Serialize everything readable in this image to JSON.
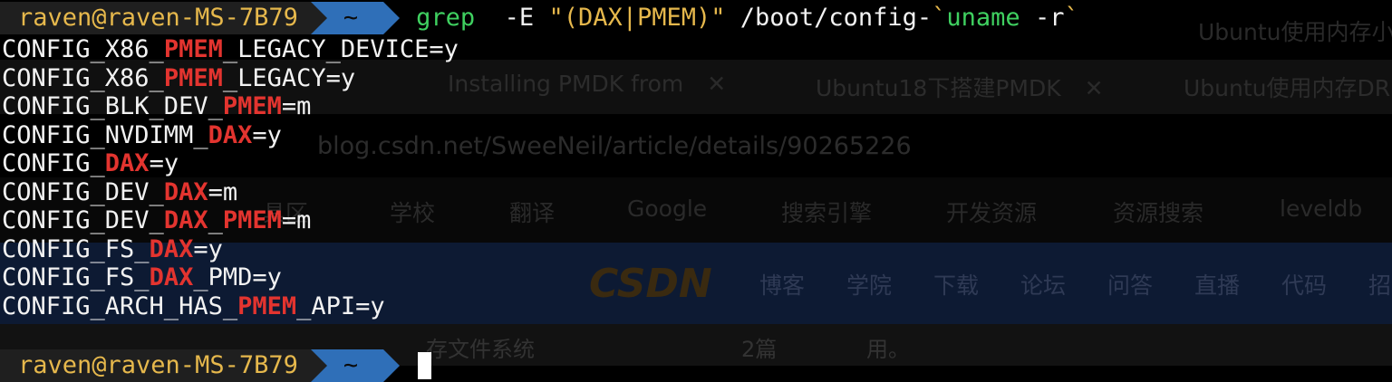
{
  "background": {
    "tabs": [
      {
        "label": "Installing PMDK from",
        "close": "✕"
      },
      {
        "label": "Ubuntu18下搭建PMDK",
        "close": "✕"
      },
      {
        "label": "Ubuntu使用内存DR",
        "close": ""
      }
    ],
    "top_right_title": "Ubuntu使用内存小",
    "url": "blog.csdn.net/SweeNeil/article/details/90265226",
    "bookmarks": [
      "具区",
      "学校",
      "翻译",
      "Google",
      "搜索引擎",
      "开发资源",
      "资源搜索",
      "leveldb"
    ],
    "logo": "CSDN",
    "nav_items": [
      "博客",
      "学院",
      "下载",
      "论坛",
      "问答",
      "直播",
      "代码",
      "招"
    ],
    "bottom_text_left": "存文件系统",
    "bottom_text_mid": "2篇",
    "bottom_text_right": "用。"
  },
  "prompt": {
    "user_host": "raven@raven-MS-7B79",
    "directory": "~"
  },
  "command": {
    "program": "grep",
    "option": "-E",
    "pattern": "\"(DAX|PMEM)\"",
    "path": "/boot/config-",
    "tick_open": "`",
    "subcommand": "uname",
    "subcommand_arg": "-r",
    "tick_close": "`"
  },
  "output_lines": [
    [
      [
        "CONFIG_X86_",
        false
      ],
      [
        "PMEM",
        true
      ],
      [
        "_LEGACY_DEVICE=y",
        false
      ]
    ],
    [
      [
        "CONFIG_X86_",
        false
      ],
      [
        "PMEM",
        true
      ],
      [
        "_LEGACY=y",
        false
      ]
    ],
    [
      [
        "CONFIG_BLK_DEV_",
        false
      ],
      [
        "PMEM",
        true
      ],
      [
        "=m",
        false
      ]
    ],
    [
      [
        "CONFIG_NVDIMM_",
        false
      ],
      [
        "DAX",
        true
      ],
      [
        "=y",
        false
      ]
    ],
    [
      [
        "CONFIG_",
        false
      ],
      [
        "DAX",
        true
      ],
      [
        "=y",
        false
      ]
    ],
    [
      [
        "CONFIG_DEV_",
        false
      ],
      [
        "DAX",
        true
      ],
      [
        "=m",
        false
      ]
    ],
    [
      [
        "CONFIG_DEV_",
        false
      ],
      [
        "DAX",
        true
      ],
      [
        "_",
        false
      ],
      [
        "PMEM",
        true
      ],
      [
        "=m",
        false
      ]
    ],
    [
      [
        "CONFIG_FS_",
        false
      ],
      [
        "DAX",
        true
      ],
      [
        "=y",
        false
      ]
    ],
    [
      [
        "CONFIG_FS_",
        false
      ],
      [
        "DAX",
        true
      ],
      [
        "_PMD=y",
        false
      ]
    ],
    [
      [
        "CONFIG_ARCH_HAS_",
        false
      ],
      [
        "PMEM",
        true
      ],
      [
        "_API=y",
        false
      ]
    ]
  ],
  "colors": {
    "match_highlight": "#e3342f",
    "prompt_user": "#e6b84c",
    "prompt_dir_bg": "#2f6fb8",
    "command_green": "#3fd060"
  }
}
